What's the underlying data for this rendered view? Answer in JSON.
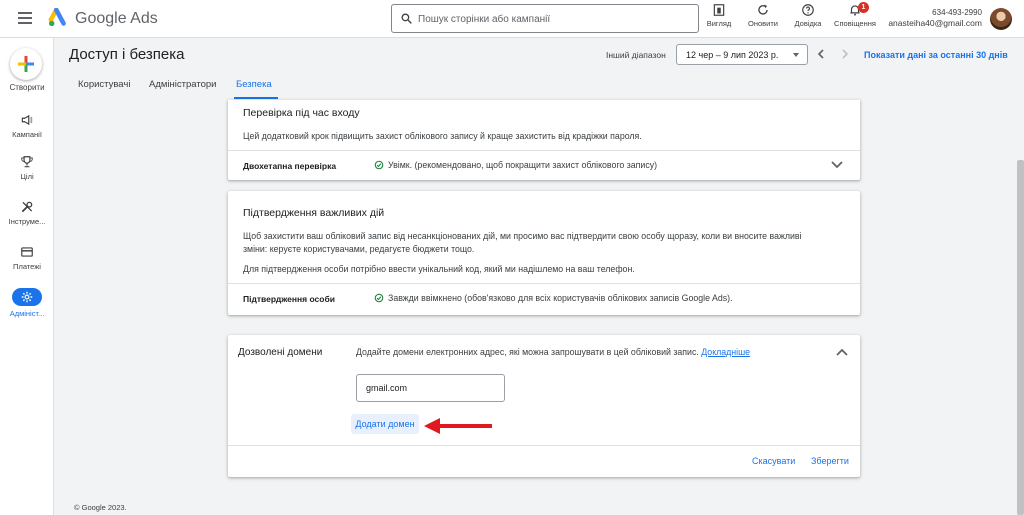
{
  "header": {
    "brand": "Google Ads",
    "search_placeholder": "Пошук сторінки або кампанії",
    "buttons": [
      {
        "label": "Вигляд",
        "icon": "appearance-icon"
      },
      {
        "label": "Оновити",
        "icon": "refresh-icon"
      },
      {
        "label": "Довідка",
        "icon": "help-icon"
      },
      {
        "label": "Сповіщення",
        "icon": "bell-icon",
        "badge": "1"
      }
    ],
    "account": {
      "phone": "634-493-2990",
      "email": "anasteiha40@gmail.com"
    }
  },
  "sidebar": {
    "create_label": "Створити",
    "items": [
      {
        "label": "Кампанії",
        "icon": "megaphone-icon"
      },
      {
        "label": "Цілі",
        "icon": "trophy-icon"
      },
      {
        "label": "Інструме...",
        "icon": "tools-icon"
      },
      {
        "label": "Платежі",
        "icon": "credit-card-icon"
      },
      {
        "label": "Адмініст...",
        "icon": "gear-icon",
        "active": true
      }
    ]
  },
  "page": {
    "title": "Доступ і безпека",
    "range_label": "Інший діапазон",
    "date_range": "12 чер – 9 лип 2023 р.",
    "last30_link": "Показати дані за останні 30 днів",
    "tabs": [
      "Користувачі",
      "Адміністратори",
      "Безпека"
    ],
    "active_tab": "Безпека"
  },
  "login_check": {
    "title": "Перевірка під час входу",
    "description": "Цей додатковий крок підвищить захист облікового запису й краще захистить від крадіжки пароля.",
    "row_label": "Двохетапна перевірка",
    "row_status": "Увімк. (рекомендовано, щоб покращити захист облікового запису)"
  },
  "important_actions": {
    "title": "Підтвердження важливих дій",
    "description_line1": "Щоб захистити ваш обліковий запис від несанкціонованих дій, ми просимо вас підтвердити свою особу щоразу, коли ви вносите важливі",
    "description_line2": "зміни: керуєте користувачами, редагуєте бюджети тощо.",
    "description2": "Для підтвердження особи потрібно ввести унікальний код, який ми надішлемо на ваш телефон.",
    "row_label": "Підтвердження особи",
    "row_status": "Завжди ввімкнено (обов'язково для всіх користувачів облікових записів Google Ads)."
  },
  "allowed_domains": {
    "title": "Дозволені домени",
    "description": "Додайте домени електронних адрес, які можна запрошувати в цей обліковий запис.",
    "learn_more": "Докладніше",
    "domain_value": "gmail.com",
    "add_button": "Додати домен",
    "cancel_button": "Скасувати",
    "save_button": "Зберегти"
  },
  "footer": {
    "copyright": "© Google 2023."
  },
  "colors": {
    "accent": "#1a73e8",
    "success": "#188038",
    "arrow": "#e0191e"
  }
}
